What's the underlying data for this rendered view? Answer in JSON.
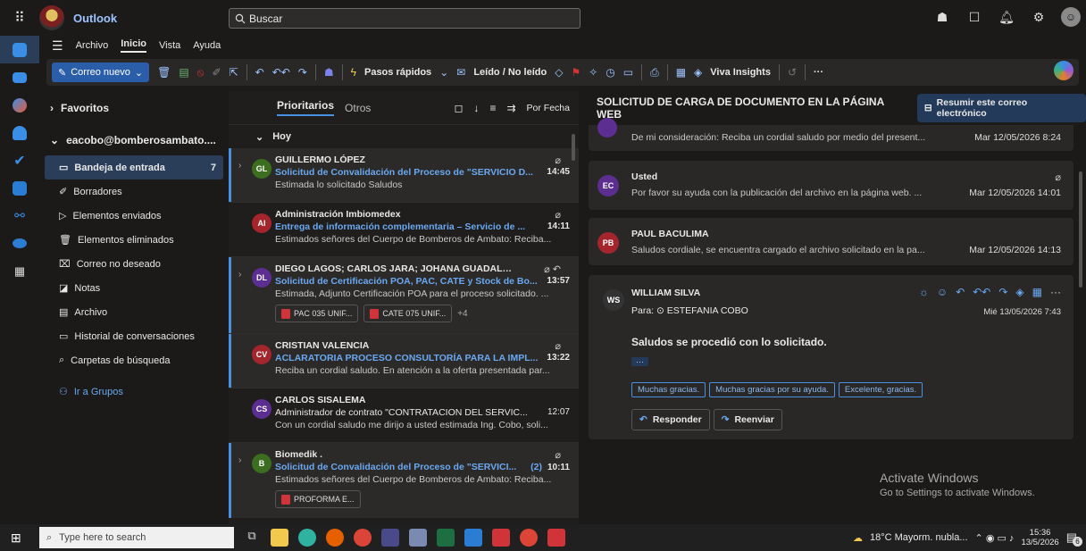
{
  "app": {
    "name": "Outlook",
    "search_placeholder": "Buscar"
  },
  "menu": {
    "tabs": [
      "Archivo",
      "Inicio",
      "Vista",
      "Ayuda"
    ]
  },
  "toolbar": {
    "new_mail": "Correo nuevo",
    "quick_steps": "Pasos rápidos",
    "read_unread": "Leído / No leído",
    "viva": "Viva Insights",
    "more": "···"
  },
  "folders": {
    "favorites": "Favoritos",
    "account": "eacobo@bomberosambato....",
    "items": [
      {
        "label": "Bandeja de entrada",
        "count": "7",
        "icon": "inbox-icon"
      },
      {
        "label": "Borradores",
        "count": "",
        "icon": "draft-icon"
      },
      {
        "label": "Elementos enviados",
        "count": "",
        "icon": "sent-icon"
      },
      {
        "label": "Elementos eliminados",
        "count": "",
        "icon": "trash-icon"
      },
      {
        "label": "Correo no deseado",
        "count": "",
        "icon": "junk-icon"
      },
      {
        "label": "Notas",
        "count": "",
        "icon": "notes-icon"
      },
      {
        "label": "Archivo",
        "count": "",
        "icon": "archive-icon"
      },
      {
        "label": "Historial de conversaciones",
        "count": "",
        "icon": "history-icon"
      },
      {
        "label": "Carpetas de búsqueda",
        "count": "",
        "icon": "search-folder-icon"
      }
    ],
    "groups": "Ir a Grupos"
  },
  "list": {
    "tab_focused": "Prioritarios",
    "tab_other": "Otros",
    "sort": "Por Fecha",
    "group": "Hoy",
    "messages": [
      {
        "initials": "GL",
        "color": "#3b6e1f",
        "from": "GUILLERMO LÓPEZ",
        "subject": "Solicitud de Convalidación del Proceso de \"SERVICIO D...",
        "time": "14:45",
        "preview": "Estimada lo solicitado Saludos",
        "unread": true
      },
      {
        "initials": "AI",
        "color": "#a4262c",
        "from": "Administración Imbiomedex",
        "subject": "Entrega de información complementaria – Servicio de ...",
        "time": "14:11",
        "preview": "Estimados señores del Cuerpo de Bomberos de Ambato: Reciba...",
        "unread": false
      },
      {
        "initials": "DL",
        "color": "#5c2e91",
        "from": "DIEGO LAGOS; CARLOS JARA; JOHANA GUADALUPE ...",
        "subject": "Solicitud de Certificación POA, PAC, CATE y Stock de Bo...",
        "time": "13:57",
        "preview": "Estimada, Adjunto Certificación POA para el proceso solicitado. ...",
        "unread": true,
        "attachments": [
          "PAC 035 UNIF...",
          "CATE 075 UNIF..."
        ],
        "more": "+4"
      },
      {
        "initials": "CV",
        "color": "#a4262c",
        "from": "CRISTIAN VALENCIA",
        "subject": "ACLARATORIA PROCESO CONSULTORÍA PARA LA IMPL...",
        "time": "13:22",
        "preview": "Reciba un cordial saludo. En atención a la oferta presentada par...",
        "unread": true
      },
      {
        "initials": "CS",
        "color": "#5c2e91",
        "from": "CARLOS SISALEMA",
        "subject": "Administrador de contrato \"CONTRATACION DEL SERVIC...",
        "time": "12:07",
        "preview": "Con un cordial saludo me dirijo a usted estimada Ing. Cobo, soli...",
        "unread": false
      },
      {
        "initials": "B",
        "color": "#3b6e1f",
        "from": "Biomedik .",
        "subject": "Solicitud de Convalidación del Proceso de \"SERVICI...",
        "count": "(2)",
        "time": "10:11",
        "preview": "Estimados señores del Cuerpo de Bomberos de Ambato: Reciba...",
        "unread": true,
        "attachments": [
          "PROFORMA E..."
        ]
      }
    ]
  },
  "reading": {
    "subject": "SOLICITUD DE CARGA DE DOCUMENTO EN LA PÁGINA WEB",
    "summarize": "Resumir este correo electrónico",
    "thread": [
      {
        "preview": "De mi consideración: Reciba un cordial saludo por medio del present...",
        "date": "Mar 12/05/2026 8:24"
      },
      {
        "initials": "EC",
        "color": "#5c2e91",
        "name": "Usted",
        "preview": "Por favor su ayuda con la publicación del archivo en la página web. ...",
        "date": "Mar 12/05/2026 14:01"
      },
      {
        "initials": "PB",
        "color": "#a4262c",
        "name": "PAUL BACULIMA",
        "preview": "Saludos cordiale, se encuentra cargado el archivo solicitado en la pa...",
        "date": "Mar 12/05/2026 14:13"
      }
    ],
    "open": {
      "initials": "WS",
      "name": "WILLIAM SILVA",
      "to_label": "Para:",
      "to": "ESTEFANIA COBO",
      "date": "Mié 13/05/2026 7:43",
      "body": "Saludos se procedió con lo solicitado.",
      "ellipsis": "···",
      "quick_replies": [
        "Muchas gracias.",
        "Muchas gracias por su ayuda.",
        "Excelente, gracias."
      ],
      "reply": "Responder",
      "forward": "Reenviar"
    }
  },
  "watermark": {
    "line1": "Activate Windows",
    "line2": "Go to Settings to activate Windows."
  },
  "taskbar": {
    "search": "Type here to search",
    "weather": "18°C  Mayorm. nubla...",
    "time": "15:36",
    "date": "13/5/2026",
    "notif_count": "6"
  }
}
